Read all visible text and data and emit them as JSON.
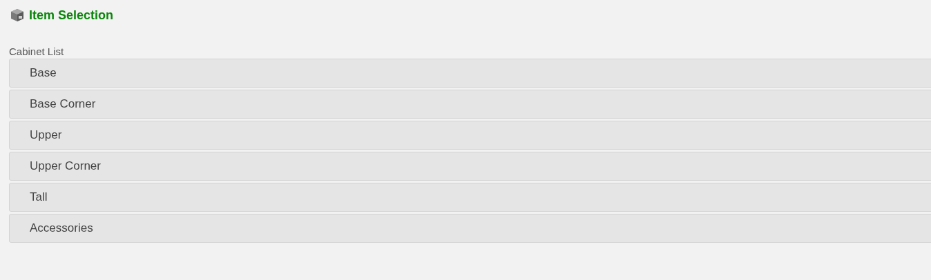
{
  "header": {
    "title": "Item Selection"
  },
  "cabinet_list": {
    "label": "Cabinet List",
    "items": [
      {
        "label": "Base"
      },
      {
        "label": "Base Corner"
      },
      {
        "label": "Upper"
      },
      {
        "label": "Upper Corner"
      },
      {
        "label": "Tall"
      },
      {
        "label": "Accessories"
      }
    ]
  }
}
